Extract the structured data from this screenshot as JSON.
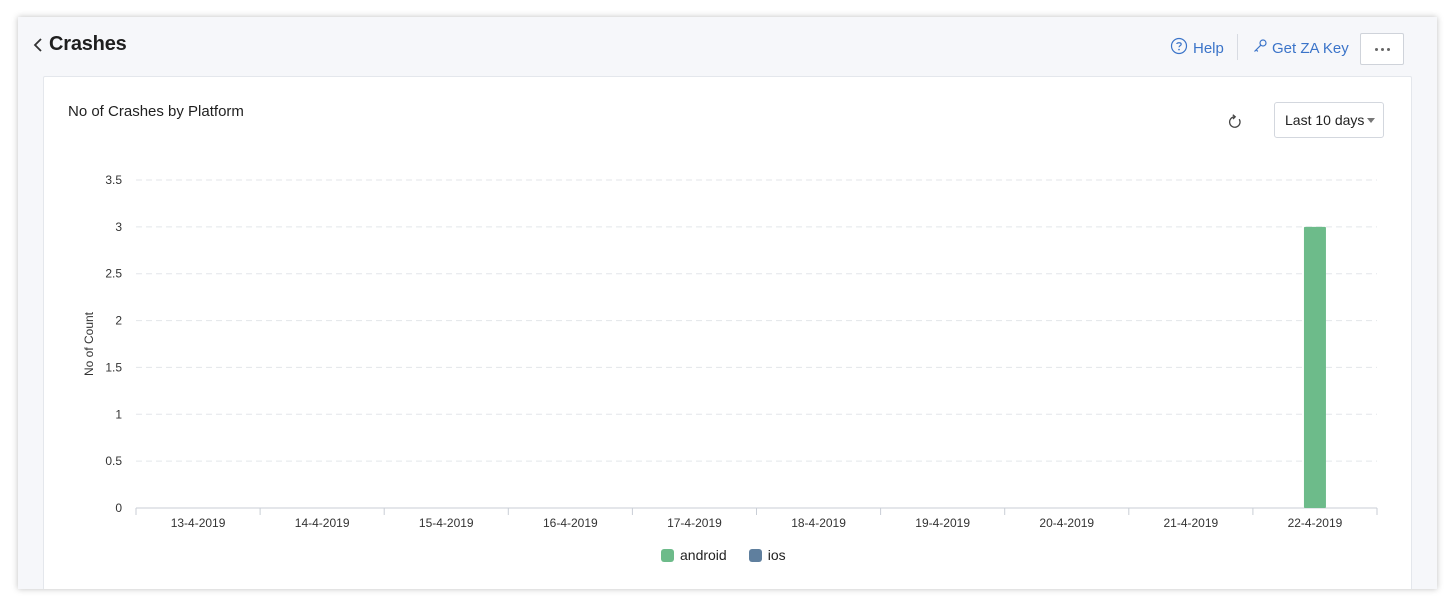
{
  "header": {
    "title": "Crashes",
    "help_label": "Help",
    "zakey_label": "Get ZA Key"
  },
  "card": {
    "title": "No of Crashes by Platform",
    "range_label": "Last 10 days"
  },
  "colors": {
    "android": "#6dbb8a",
    "ios": "#5f7f9e",
    "link": "#3b74c9",
    "grid": "#e3e6ea"
  },
  "icons": {
    "back": "chevron-left-icon",
    "help": "question-circle-icon",
    "key": "key-icon",
    "more": "ellipsis-icon",
    "refresh": "refresh-icon",
    "caret": "caret-down-icon"
  },
  "chart_data": {
    "type": "bar",
    "title": "No of Crashes by Platform",
    "xlabel": "",
    "ylabel": "No of Count",
    "ylim": [
      0,
      3.5
    ],
    "yticks": [
      "0",
      "0.5",
      "1",
      "1.5",
      "2",
      "2.5",
      "3",
      "3.5"
    ],
    "categories": [
      "13-4-2019",
      "14-4-2019",
      "15-4-2019",
      "16-4-2019",
      "17-4-2019",
      "18-4-2019",
      "19-4-2019",
      "20-4-2019",
      "21-4-2019",
      "22-4-2019"
    ],
    "series": [
      {
        "name": "android",
        "values": [
          0,
          0,
          0,
          0,
          0,
          0,
          0,
          0,
          0,
          3
        ]
      },
      {
        "name": "ios",
        "values": [
          0,
          0,
          0,
          0,
          0,
          0,
          0,
          0,
          0,
          0
        ]
      }
    ],
    "grid": true,
    "legend_position": "bottom"
  }
}
